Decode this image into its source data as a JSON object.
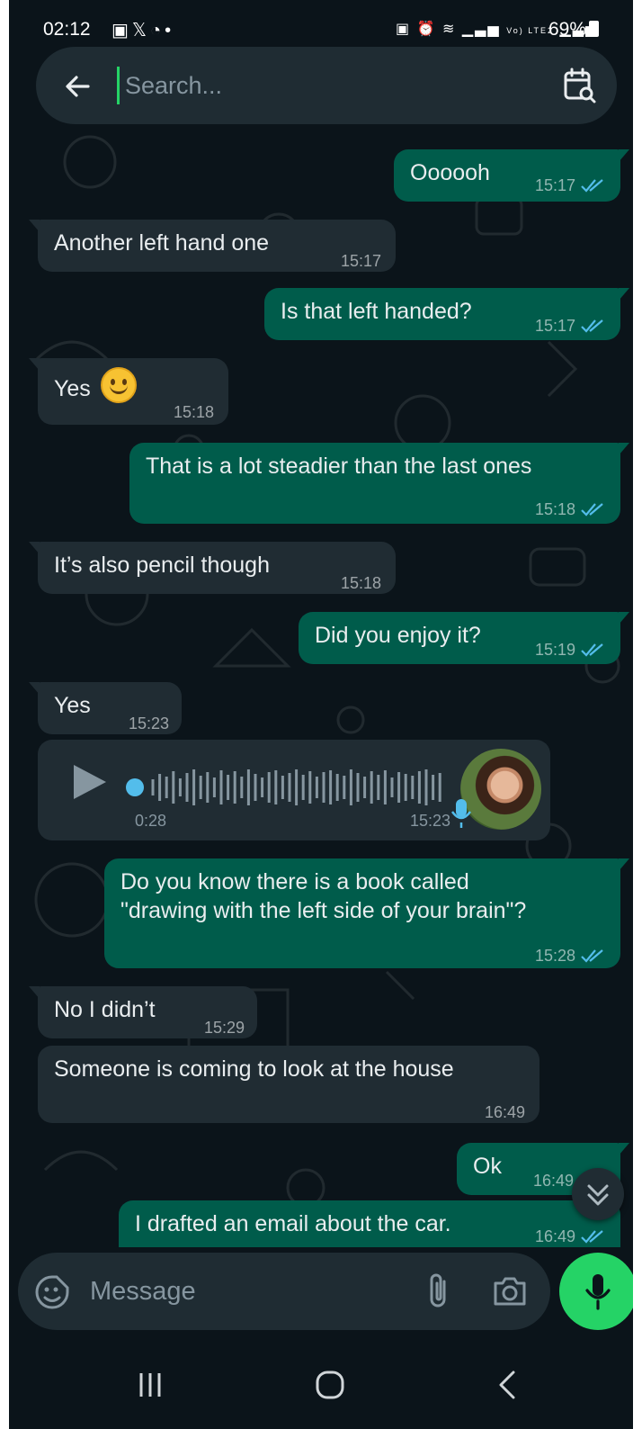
{
  "status_bar": {
    "time": "02:12",
    "left_icons": [
      "image-icon",
      "x-icon",
      "stopwatch-icon",
      "dot-icon"
    ],
    "right_icons": [
      "battery-saver-icon",
      "alarm-icon",
      "wifi-icon",
      "signal-icon",
      "volte-icon",
      "signal-icon"
    ],
    "volte_label": "Vo) LTE2",
    "battery": "69%"
  },
  "search": {
    "placeholder": "Search..."
  },
  "messages": [
    {
      "direction": "out",
      "text": "Oooooh",
      "time": "15:17",
      "read": true
    },
    {
      "direction": "in",
      "text": "Another left hand one",
      "time": "15:17"
    },
    {
      "direction": "out",
      "text": "Is that left handed?",
      "time": "15:17",
      "read": true
    },
    {
      "direction": "in",
      "text": "Yes",
      "emoji": "🙂",
      "time": "15:18"
    },
    {
      "direction": "out",
      "text": "That is a lot steadier than the last ones",
      "time": "15:18",
      "read": true
    },
    {
      "direction": "in",
      "text": "It’s also pencil though",
      "time": "15:18"
    },
    {
      "direction": "out",
      "text": "Did you enjoy it?",
      "time": "15:19",
      "read": true
    },
    {
      "direction": "in",
      "text": "Yes",
      "time": "15:23"
    },
    {
      "direction": "out",
      "text_lines": [
        "Do you know there is a book called",
        "\"drawing with the left side of your brain\"?"
      ],
      "time": "15:28",
      "read": true
    },
    {
      "direction": "in",
      "text": "No I didn’t",
      "time": "15:29"
    },
    {
      "direction": "in",
      "text": "Someone is coming to look at the house",
      "time": "16:49"
    },
    {
      "direction": "out",
      "text": "Ok",
      "time": "16:49"
    },
    {
      "direction": "out",
      "text": "I drafted an email about the car.",
      "time": "16:49",
      "read": true
    }
  ],
  "voice_note": {
    "duration": "0:28",
    "time": "15:23",
    "progress": 0.0
  },
  "composer": {
    "placeholder": "Message"
  },
  "colors": {
    "background": "#0b141a",
    "incoming_bubble": "#202c33",
    "outgoing_bubble": "#005c4b",
    "accent_green": "#25d366",
    "read_ticks": "#53bdeb"
  }
}
